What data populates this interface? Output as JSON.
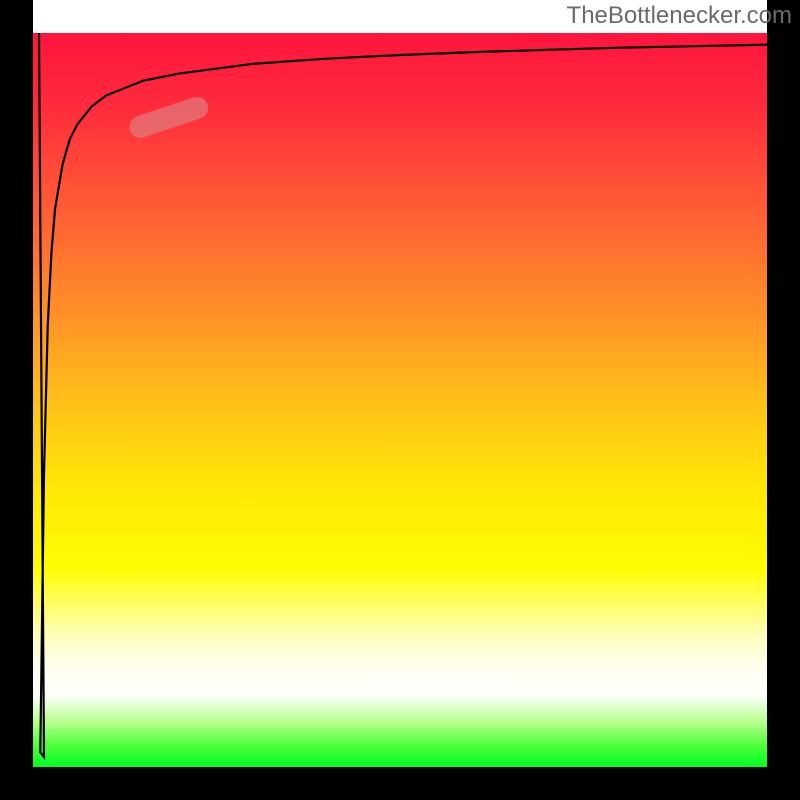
{
  "watermark": "TheBottlenecker.com",
  "chart_data": {
    "type": "line",
    "title": "",
    "xlabel": "",
    "ylabel": "",
    "xlim": [
      0,
      100
    ],
    "ylim": [
      0,
      100
    ],
    "x": [
      1,
      1.5,
      2,
      2.5,
      3,
      4,
      5,
      6,
      8,
      10,
      15,
      20,
      30,
      40,
      50,
      60,
      70,
      80,
      90,
      100
    ],
    "values": [
      2,
      40,
      60,
      70,
      76,
      82,
      85.5,
      87.5,
      90,
      91.5,
      93.5,
      94.5,
      95.8,
      96.5,
      97,
      97.4,
      97.7,
      98,
      98.2,
      98.4
    ],
    "gradient": {
      "type": "vertical",
      "stops": [
        {
          "pos": 0.0,
          "color": "#ff143d"
        },
        {
          "pos": 0.5,
          "color": "#ffe706"
        },
        {
          "pos": 0.82,
          "color": "#fffeba"
        },
        {
          "pos": 0.9,
          "color": "#ffffff"
        },
        {
          "pos": 1.0,
          "color": "#00ff24"
        }
      ]
    },
    "marker": {
      "x_range": [
        14,
        23
      ],
      "y_range": [
        87,
        90
      ],
      "color": "rgba(220,130,130,0.65)"
    }
  }
}
